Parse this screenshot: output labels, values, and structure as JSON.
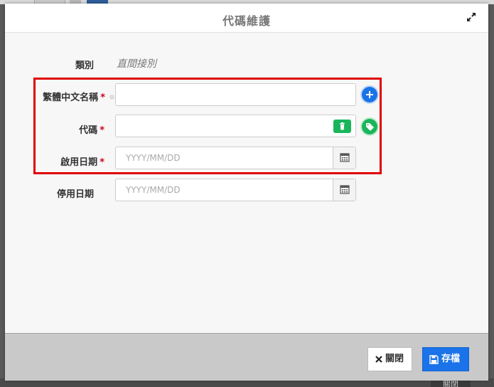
{
  "dialog": {
    "title": "代碼維護"
  },
  "form": {
    "category": {
      "label": "類別",
      "value": "直間接別"
    },
    "name_zh": {
      "label": "繁體中文名稱",
      "required_mark": "*",
      "value": ""
    },
    "code": {
      "label": "代碼",
      "required_mark": "*",
      "value": ""
    },
    "start_date": {
      "label": "啟用日期",
      "required_mark": "*",
      "placeholder": "YYYY/MM/DD"
    },
    "end_date": {
      "label": "停用日期",
      "placeholder": "YYYY/MM/DD"
    }
  },
  "footer": {
    "close_label": "關閉",
    "save_label": "存檔"
  },
  "background": {
    "ghost_button_label": "關閉"
  },
  "colors": {
    "primary": "#1a73e8",
    "success": "#1ab55b",
    "required": "#d0021b",
    "highlight": "#e00000"
  },
  "icons": [
    "expand-icon",
    "plus-icon",
    "trash-icon",
    "tag-icon",
    "calendar-icon",
    "close-x-icon",
    "save-icon"
  ]
}
